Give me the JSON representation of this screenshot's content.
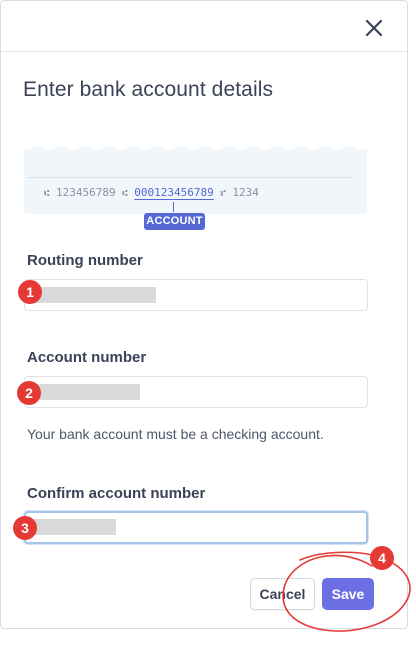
{
  "dialog": {
    "close_icon": "close-icon",
    "title": "Enter bank account details"
  },
  "check": {
    "routing_digits": "123456789",
    "account_digits": "000123456789",
    "check_digits": "1234",
    "badge": "ACCOUNT"
  },
  "form": {
    "routing_label": "Routing number",
    "account_label": "Account number",
    "helper": "Your bank account must be a checking account.",
    "confirm_label": "Confirm account number"
  },
  "buttons": {
    "cancel": "Cancel",
    "save": "Save"
  },
  "annotations": {
    "marker_color": "#e53935",
    "steps": [
      "1",
      "2",
      "3",
      "4"
    ]
  },
  "colors": {
    "accent": "#5469d4",
    "save_bg": "#6b6fe3"
  }
}
